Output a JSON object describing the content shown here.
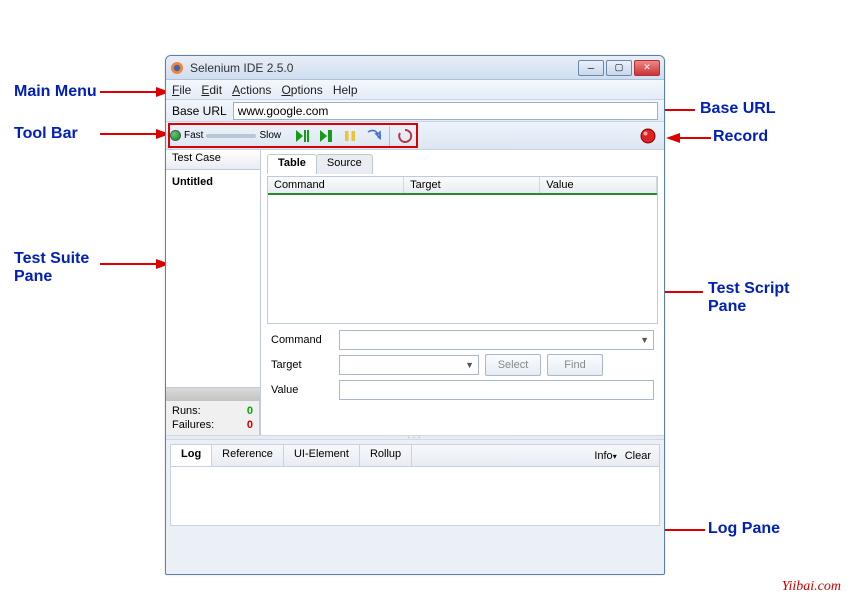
{
  "window": {
    "title": "Selenium IDE 2.5.0"
  },
  "menus": {
    "file": "File",
    "edit": "Edit",
    "actions": "Actions",
    "options": "Options",
    "help": "Help"
  },
  "baseurl": {
    "label": "Base URL",
    "value": "www.google.com"
  },
  "speed": {
    "fast": "Fast",
    "slow": "Slow"
  },
  "sidebar": {
    "tab": "Test Case",
    "items": [
      "Untitled"
    ]
  },
  "stats": {
    "runs_label": "Runs:",
    "runs_value": "0",
    "fails_label": "Failures:",
    "fails_value": "0"
  },
  "tabs": {
    "table": "Table",
    "source": "Source"
  },
  "grid": {
    "col1": "Command",
    "col2": "Target",
    "col3": "Value"
  },
  "form": {
    "command_label": "Command",
    "target_label": "Target",
    "value_label": "Value",
    "select_btn": "Select",
    "find_btn": "Find"
  },
  "log": {
    "log": "Log",
    "reference": "Reference",
    "uielement": "UI-Element",
    "rollup": "Rollup",
    "info": "Info",
    "clear": "Clear"
  },
  "annotations": {
    "main_menu": "Main Menu",
    "tool_bar": "Tool Bar",
    "base_url": "Base URL",
    "record": "Record",
    "test_suite_pane": "Test Suite\nPane",
    "test_script_pane": "Test Script\nPane",
    "log_pane": "Log Pane"
  },
  "watermark": "Yiibai.com"
}
